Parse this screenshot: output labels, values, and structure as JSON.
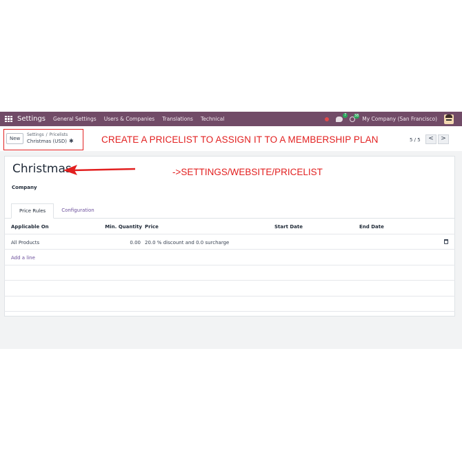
{
  "navbar": {
    "app_name": "Settings",
    "menu": [
      "General Settings",
      "Users & Companies",
      "Translations",
      "Technical"
    ],
    "chat_count": "7",
    "activity_count": "38",
    "company": "My Company (San Francisco)"
  },
  "control": {
    "new_label": "New",
    "breadcrumb": [
      "Settings",
      "Pricelists"
    ],
    "breadcrumb_sep": "/",
    "record_name": "Christmas (USD)",
    "pager": "5 / 5",
    "prev": "<",
    "next": ">"
  },
  "annotations": {
    "main": "CREATE A PRICELIST TO ASSIGN IT TO A MEMBERSHIP PLAN",
    "path": "->SETTINGS/WEBSITE/PRICELIST"
  },
  "form": {
    "title": "Christmas",
    "company_label": "Company",
    "tabs": [
      "Price Rules",
      "Configuration"
    ],
    "columns": [
      "Applicable On",
      "Min. Quantity",
      "Price",
      "Start Date",
      "End Date"
    ],
    "rows": [
      {
        "applicable_on": "All Products",
        "min_quantity": "0.00",
        "price": "20.0 % discount and 0.0 surcharge",
        "start_date": "",
        "end_date": ""
      }
    ],
    "add_line": "Add a line"
  },
  "colors": {
    "navbar": "#714b67",
    "accent": "#6b4e9b",
    "annotation": "#e21f1f"
  }
}
